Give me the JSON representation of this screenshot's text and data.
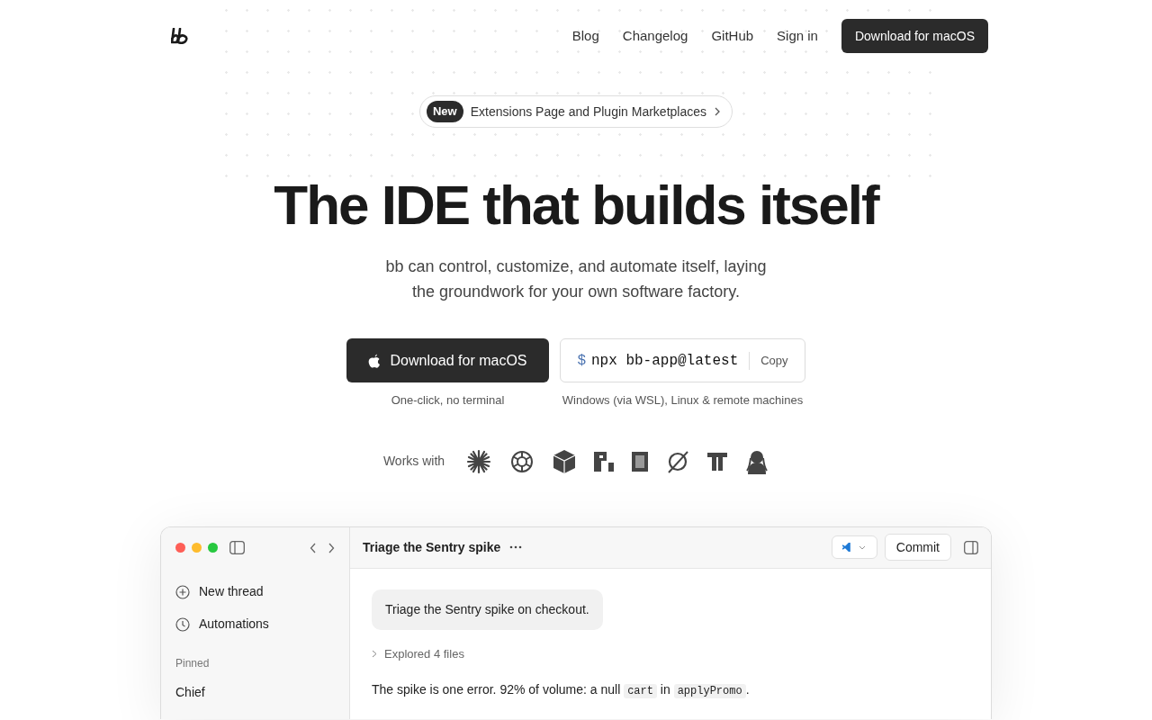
{
  "nav": {
    "links": [
      "Blog",
      "Changelog",
      "GitHub",
      "Sign in"
    ],
    "cta": "Download for macOS"
  },
  "announcement": {
    "badge": "New",
    "text": "Extensions Page and Plugin Marketplaces"
  },
  "hero": {
    "title": "The IDE that builds itself",
    "subtitle": [
      "bb can control, customize, and automate itself, laying",
      "the groundwork for your own software factory."
    ]
  },
  "download": {
    "label": "Download for macOS",
    "caption": "One-click, no terminal"
  },
  "install": {
    "prompt": "$",
    "command": "npx bb-app@latest",
    "copy": "Copy",
    "caption": "Windows (via WSL), Linux & remote machines"
  },
  "works_with": {
    "label": "Works with",
    "logos": [
      {
        "kind": "asterisk"
      },
      {
        "kind": "knot"
      },
      {
        "kind": "cube"
      },
      {
        "kind": "blocks"
      },
      {
        "kind": "square"
      },
      {
        "kind": "slash-circle"
      },
      {
        "kind": "tt"
      },
      {
        "kind": "figure"
      }
    ]
  },
  "app": {
    "sidebar": {
      "actions": [
        {
          "kind": "new",
          "label": "New thread"
        },
        {
          "kind": "clock",
          "label": "Automations"
        }
      ],
      "section": "Pinned",
      "pinned": [
        "Chief"
      ]
    },
    "thread_title": "Triage the Sentry spike",
    "commit": "Commit",
    "messages": [
      {
        "kind": "user",
        "text": "Triage the Sentry spike on checkout."
      },
      {
        "kind": "step",
        "text": "Explored 4 files"
      },
      {
        "kind": "reply",
        "parts": [
          {
            "kind": "text",
            "text": "The spike is one error. 92% of volume: a null "
          },
          {
            "kind": "code",
            "text": "cart"
          },
          {
            "kind": "text",
            "text": " in "
          },
          {
            "kind": "code",
            "text": "applyPromo"
          },
          {
            "kind": "text",
            "text": "."
          }
        ]
      }
    ]
  }
}
